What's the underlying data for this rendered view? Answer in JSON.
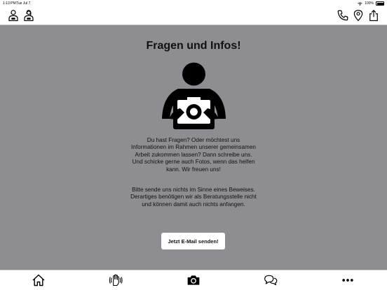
{
  "status": {
    "time": "1:13 PM",
    "date": "Tue Jul 7",
    "battery": "100%"
  },
  "nav": {
    "left_icons": [
      "counselor-icon",
      "counselor-female-icon"
    ],
    "right_icons": [
      "phone-icon",
      "location-pin-icon",
      "share-icon"
    ]
  },
  "main": {
    "title": "Fragen und Infos!",
    "paragraph1": "Du hast Fragen? Oder möchtest uns Informationen im Rahmen unserer gemeinsamen Arbeit zukommen lassen? Dann schreibe uns. Und schicke gerne auch Fotos, wenn das helfen kann. Wir freuen uns!",
    "paragraph2": "Bitte sende uns nichts im Sinne eines Beweises. Derartiges benötigen wir als Beratungsstelle nicht und können damit auch nichts anfangen.",
    "email_button": "Jetzt E-Mail senden!"
  },
  "tabs": [
    "home-icon",
    "hand-signal-icon",
    "camera-icon",
    "chat-bubbles-icon",
    "more-icon"
  ],
  "colors": {
    "background": "#8e8d92",
    "bars": "#ffffff",
    "text": "#111111"
  }
}
